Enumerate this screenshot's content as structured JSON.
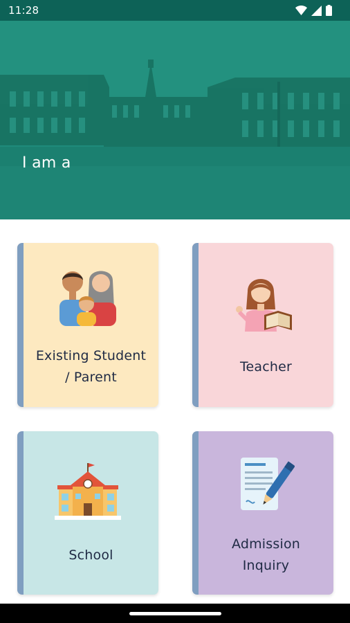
{
  "status_bar": {
    "time": "11:28"
  },
  "hero": {
    "prompt": "I am a"
  },
  "options": [
    {
      "label_line1": "Existing Student",
      "label_line2": "/ Parent",
      "icon": "family-icon",
      "color": "#fde9c0"
    },
    {
      "label_line1": "Teacher",
      "label_line2": "",
      "icon": "teacher-icon",
      "color": "#f9d6d9"
    },
    {
      "label_line1": "School",
      "label_line2": "",
      "icon": "school-building-icon",
      "color": "#c7e6e6"
    },
    {
      "label_line1": "Admission",
      "label_line2": "Inquiry",
      "icon": "admission-form-icon",
      "color": "#c9b6dc"
    }
  ],
  "colors": {
    "status_bar": "#0d6257",
    "hero_overlay": "#1e8a7a",
    "card_accent": "#7f9ec0",
    "label_text": "#1f2a44"
  }
}
